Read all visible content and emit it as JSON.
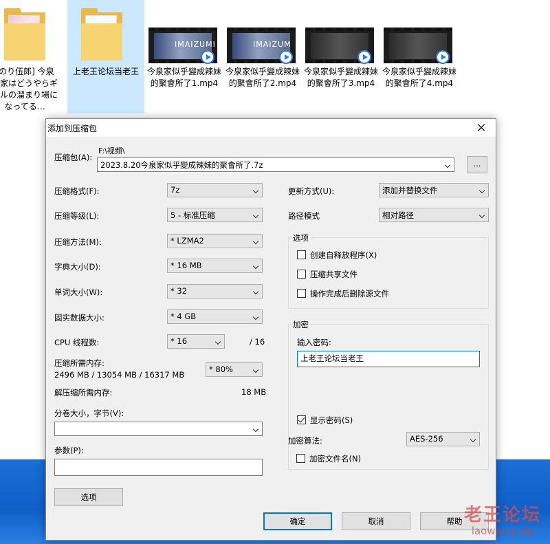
{
  "explorer": {
    "files": [
      {
        "name": "[のり伍郎] 今泉ん家はどうやらギャルの溜まり場になってる…",
        "type": "folder"
      },
      {
        "name": "上老王论坛当老王",
        "type": "folder",
        "selected": true
      },
      {
        "name": "今泉家似乎變成辣妹的聚會所了1.mp4",
        "type": "video",
        "frame_text": "IMAIZUMI"
      },
      {
        "name": "今泉家似乎變成辣妹的聚會所了2.mp4",
        "type": "video",
        "frame_text": "IMAIZUM"
      },
      {
        "name": "今泉家似乎變成辣妹的聚會所了3.mp4",
        "type": "video",
        "frame_text": ""
      },
      {
        "name": "今泉家似乎變成辣妹的聚會所了4.mp4",
        "type": "video",
        "frame_text": ""
      }
    ]
  },
  "dialog": {
    "title": "添加到压缩包",
    "close_icon": "×",
    "archive_label": "压缩包(A):",
    "archive_dir": "F:\\视频\\",
    "archive_name": "2023.8.20今泉家似乎變成辣妹的聚會所了.7z",
    "browse_label": "...",
    "left": {
      "format_label": "压缩格式(F):",
      "format_value": "7z",
      "level_label": "压缩等级(L):",
      "level_value": "5 - 标准压缩",
      "method_label": "压缩方法(M):",
      "method_value": "* LZMA2",
      "dict_label": "字典大小(D):",
      "dict_value": "* 16 MB",
      "word_label": "单词大小(W):",
      "word_value": "* 32",
      "solid_label": "固实数据大小:",
      "solid_value": "* 4 GB",
      "threads_label": "CPU 线程数:",
      "threads_value": "* 16",
      "threads_max": "/ 16",
      "mem_label": "压缩所需内存:",
      "mem_detail": "2496 MB / 13054 MB / 16317 MB",
      "mem_value": "* 80%",
      "decomp_label": "解压缩所需内存:",
      "decomp_value": "18 MB",
      "split_label": "分卷大小，字节(V):",
      "split_value": "",
      "params_label": "参数(P):",
      "params_value": "",
      "options_button": "选项"
    },
    "right": {
      "update_label": "更新方式(U):",
      "update_value": "添加并替换文件",
      "path_label": "路径模式",
      "path_value": "相对路径",
      "options_group": "选项",
      "opt_sfx": "创建自释放程序(X)",
      "opt_shared": "压缩共享文件",
      "opt_delete": "操作完成后删除源文件",
      "encrypt_group": "加密",
      "password_label": "输入密码:",
      "password_value": "上老王论坛当老王",
      "show_password": "显示密码(S)",
      "algo_label": "加密算法:",
      "algo_value": "AES-256",
      "encrypt_names": "加密文件名(N)"
    },
    "buttons": {
      "ok": "确定",
      "cancel": "取消",
      "help": "帮助"
    }
  },
  "watermark": {
    "main": "老王论坛",
    "sub": "laowang.vip"
  }
}
